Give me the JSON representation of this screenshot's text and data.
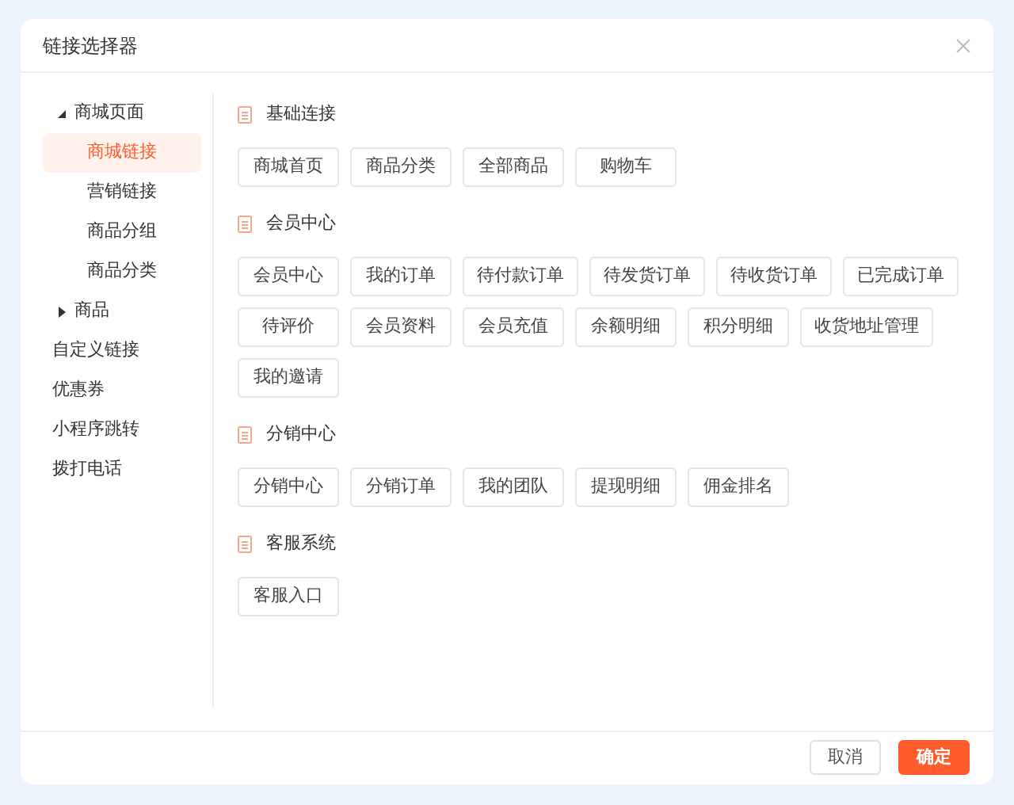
{
  "dialog": {
    "title": "链接选择器"
  },
  "sidebar": {
    "items": [
      {
        "label": "商城页面",
        "expanded": true,
        "selected": false,
        "children": [
          {
            "label": "商城链接",
            "selected": true
          },
          {
            "label": "营销链接",
            "selected": false
          },
          {
            "label": "商品分组",
            "selected": false
          },
          {
            "label": "商品分类",
            "selected": false
          }
        ]
      },
      {
        "label": "商品",
        "expanded": false,
        "selected": false
      },
      {
        "label": "自定义链接",
        "selected": false
      },
      {
        "label": "优惠券",
        "selected": false
      },
      {
        "label": "小程序跳转",
        "selected": false
      },
      {
        "label": "拨打电话",
        "selected": false
      }
    ]
  },
  "sections": [
    {
      "title": "基础连接",
      "links": [
        "商城首页",
        "商品分类",
        "全部商品",
        "购物车"
      ]
    },
    {
      "title": "会员中心",
      "links": [
        "会员中心",
        "我的订单",
        "待付款订单",
        "待发货订单",
        "待收货订单",
        "已完成订单",
        "待评价",
        "会员资料",
        "会员充值",
        "余额明细",
        "积分明细",
        "收货地址管理",
        "我的邀请"
      ]
    },
    {
      "title": "分销中心",
      "links": [
        "分销中心",
        "分销订单",
        "我的团队",
        "提现明细",
        "佣金排名"
      ]
    },
    {
      "title": "客服系统",
      "links": [
        "客服入口"
      ]
    }
  ],
  "footer": {
    "buttons": [
      {
        "label": "取消",
        "kind": "secondary"
      },
      {
        "label": "确定",
        "kind": "primary"
      }
    ]
  }
}
